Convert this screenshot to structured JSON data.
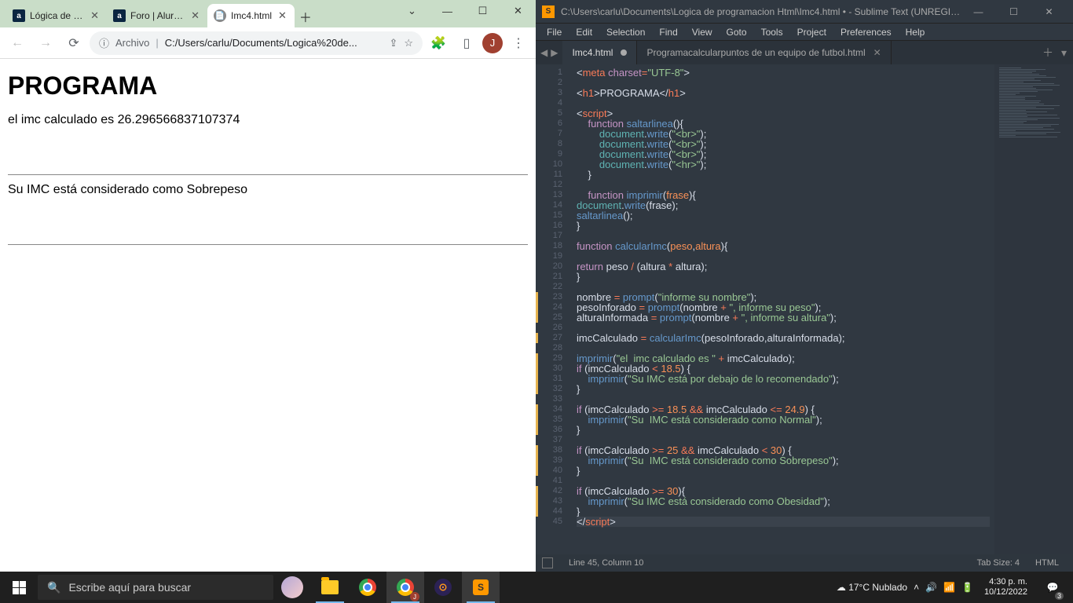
{
  "chrome": {
    "tabs": [
      {
        "title": "Lógica de pro",
        "fav": "a"
      },
      {
        "title": "Foro | Alura L",
        "fav": "a"
      },
      {
        "title": "Imc4.html",
        "fav": "",
        "active": true
      }
    ],
    "toolbar": {
      "file_label": "Archivo",
      "url": "C:/Users/carlu/Documents/Logica%20de..."
    },
    "avatar_letter": "J",
    "page": {
      "h1": "PROGRAMA",
      "p1": "el imc calculado es 26.296566837107374",
      "p2": "Su IMC está considerado como Sobrepeso"
    }
  },
  "sublime": {
    "title": "C:\\Users\\carlu\\Documents\\Logica de programacion Html\\Imc4.html • - Sublime Text (UNREGIS...",
    "menu": [
      "File",
      "Edit",
      "Selection",
      "Find",
      "View",
      "Goto",
      "Tools",
      "Project",
      "Preferences",
      "Help"
    ],
    "tabs": [
      {
        "title": "Imc4.html",
        "dirty": true,
        "active": true
      },
      {
        "title": "Programacalcularpuntos de un equipo de futbol.html",
        "dirty": false,
        "active": false
      }
    ],
    "status": {
      "pos": "Line 45, Column 10",
      "tabsize": "Tab Size: 4",
      "lang": "HTML"
    },
    "code": [
      {
        "n": 1,
        "html": "<span class='c-pun'>&lt;</span><span class='c-tag'>meta</span> <span class='c-attr'>charset</span><span class='c-op'>=</span><span class='c-str'>\"UTF-8\"</span><span class='c-pun'>&gt;</span>"
      },
      {
        "n": 2,
        "html": ""
      },
      {
        "n": 3,
        "html": "<span class='c-pun'>&lt;</span><span class='c-tag'>h1</span><span class='c-pun'>&gt;</span>PROGRAMA<span class='c-pun'>&lt;/</span><span class='c-tag'>h1</span><span class='c-pun'>&gt;</span>"
      },
      {
        "n": 4,
        "html": ""
      },
      {
        "n": 5,
        "html": "<span class='c-pun'>&lt;</span><span class='c-tag'>script</span><span class='c-pun'>&gt;</span>"
      },
      {
        "n": 6,
        "html": "    <span class='c-kw'>function</span> <span class='c-fn'>saltarlinea</span><span class='c-pun'>(){</span>"
      },
      {
        "n": 7,
        "html": "        <span class='c-obj'>document</span><span class='c-pun'>.</span><span class='c-fn'>write</span><span class='c-pun'>(</span><span class='c-str'>\"&lt;br&gt;\"</span><span class='c-pun'>);</span>"
      },
      {
        "n": 8,
        "html": "        <span class='c-obj'>document</span><span class='c-pun'>.</span><span class='c-fn'>write</span><span class='c-pun'>(</span><span class='c-str'>\"&lt;br&gt;\"</span><span class='c-pun'>);</span>"
      },
      {
        "n": 9,
        "html": "        <span class='c-obj'>document</span><span class='c-pun'>.</span><span class='c-fn'>write</span><span class='c-pun'>(</span><span class='c-str'>\"&lt;br&gt;\"</span><span class='c-pun'>);</span>"
      },
      {
        "n": 10,
        "html": "        <span class='c-obj'>document</span><span class='c-pun'>.</span><span class='c-fn'>write</span><span class='c-pun'>(</span><span class='c-str'>\"&lt;hr&gt;\"</span><span class='c-pun'>);</span>"
      },
      {
        "n": 11,
        "html": "    <span class='c-pun'>}</span>"
      },
      {
        "n": 12,
        "html": ""
      },
      {
        "n": 13,
        "html": "    <span class='c-kw'>function</span> <span class='c-fn'>imprimir</span><span class='c-pun'>(</span><span class='c-param'>frase</span><span class='c-pun'>){</span>"
      },
      {
        "n": 14,
        "html": "<span class='c-obj'>document</span><span class='c-pun'>.</span><span class='c-fn'>write</span><span class='c-pun'>(</span><span class='c-var'>frase</span><span class='c-pun'>);</span>"
      },
      {
        "n": 15,
        "html": "<span class='c-fn'>saltarlinea</span><span class='c-pun'>();</span>"
      },
      {
        "n": 16,
        "html": "<span class='c-pun'>}</span>"
      },
      {
        "n": 17,
        "html": ""
      },
      {
        "n": 18,
        "html": "<span class='c-kw'>function</span> <span class='c-fn'>calcularImc</span><span class='c-pun'>(</span><span class='c-param'>peso</span><span class='c-pun'>,</span><span class='c-param'>altura</span><span class='c-pun'>){</span>"
      },
      {
        "n": 19,
        "html": ""
      },
      {
        "n": 20,
        "html": "<span class='c-kw'>return</span> <span class='c-var'>peso</span> <span class='c-op'>/</span> <span class='c-pun'>(</span><span class='c-var'>altura</span> <span class='c-op'>*</span> <span class='c-var'>altura</span><span class='c-pun'>);</span>"
      },
      {
        "n": 21,
        "html": "<span class='c-pun'>}</span>"
      },
      {
        "n": 22,
        "html": ""
      },
      {
        "n": 23,
        "mod": true,
        "html": "<span class='c-var'>nombre</span> <span class='c-op'>=</span> <span class='c-fn'>prompt</span><span class='c-pun'>(</span><span class='c-str'>\"informe su nombre\"</span><span class='c-pun'>);</span>"
      },
      {
        "n": 24,
        "mod": true,
        "html": "<span class='c-var'>pesoInforado</span> <span class='c-op'>=</span> <span class='c-fn'>prompt</span><span class='c-pun'>(</span><span class='c-var'>nombre</span> <span class='c-op'>+</span> <span class='c-str'>\", informe su peso\"</span><span class='c-pun'>);</span>"
      },
      {
        "n": 25,
        "mod": true,
        "html": "<span class='c-var'>alturaInformada</span> <span class='c-op'>=</span> <span class='c-fn'>prompt</span><span class='c-pun'>(</span><span class='c-var'>nombre</span> <span class='c-op'>+</span> <span class='c-str'>\", informe su altura\"</span><span class='c-pun'>);</span>"
      },
      {
        "n": 26,
        "html": ""
      },
      {
        "n": 27,
        "mod": true,
        "html": "<span class='c-var'>imcCalculado</span> <span class='c-op'>=</span> <span class='c-fn'>calcularImc</span><span class='c-pun'>(</span><span class='c-var'>pesoInforado</span><span class='c-pun'>,</span><span class='c-var'>alturaInformada</span><span class='c-pun'>);</span>"
      },
      {
        "n": 28,
        "html": ""
      },
      {
        "n": 29,
        "mod": true,
        "html": "<span class='c-fn'>imprimir</span><span class='c-pun'>(</span><span class='c-str'>\"el  imc calculado es \"</span> <span class='c-op'>+</span> <span class='c-var'>imcCalculado</span><span class='c-pun'>);</span>"
      },
      {
        "n": 30,
        "mod": true,
        "html": "<span class='c-kw'>if</span> <span class='c-pun'>(</span><span class='c-var'>imcCalculado</span> <span class='c-op'>&lt;</span> <span class='c-num'>18.5</span><span class='c-pun'>) {</span>"
      },
      {
        "n": 31,
        "mod": true,
        "html": "    <span class='c-fn'>imprimir</span><span class='c-pun'>(</span><span class='c-str'>\"Su IMC está por debajo de lo recomendado\"</span><span class='c-pun'>);</span>"
      },
      {
        "n": 32,
        "mod": true,
        "html": "<span class='c-pun'>}</span>"
      },
      {
        "n": 33,
        "html": ""
      },
      {
        "n": 34,
        "mod": true,
        "html": "<span class='c-kw'>if</span> <span class='c-pun'>(</span><span class='c-var'>imcCalculado</span> <span class='c-op'>&gt;=</span> <span class='c-num'>18.5</span> <span class='c-op'>&amp;&amp;</span> <span class='c-var'>imcCalculado</span> <span class='c-op'>&lt;=</span> <span class='c-num'>24.9</span><span class='c-pun'>) {</span>"
      },
      {
        "n": 35,
        "mod": true,
        "html": "    <span class='c-fn'>imprimir</span><span class='c-pun'>(</span><span class='c-str'>\"Su  IMC está considerado como Normal\"</span><span class='c-pun'>);</span>"
      },
      {
        "n": 36,
        "mod": true,
        "html": "<span class='c-pun'>}</span>"
      },
      {
        "n": 37,
        "html": ""
      },
      {
        "n": 38,
        "mod": true,
        "html": "<span class='c-kw'>if</span> <span class='c-pun'>(</span><span class='c-var'>imcCalculado</span> <span class='c-op'>&gt;=</span> <span class='c-num'>25</span> <span class='c-op'>&amp;&amp;</span> <span class='c-var'>imcCalculado</span> <span class='c-op'>&lt;</span> <span class='c-num'>30</span><span class='c-pun'>) {</span>"
      },
      {
        "n": 39,
        "mod": true,
        "html": "    <span class='c-fn'>imprimir</span><span class='c-pun'>(</span><span class='c-str'>\"Su  IMC está considerado como Sobrepeso\"</span><span class='c-pun'>);</span>"
      },
      {
        "n": 40,
        "mod": true,
        "html": "<span class='c-pun'>}</span>"
      },
      {
        "n": 41,
        "html": ""
      },
      {
        "n": 42,
        "mod": true,
        "html": "<span class='c-kw'>if</span> <span class='c-pun'>(</span><span class='c-var'>imcCalculado</span> <span class='c-op'>&gt;=</span> <span class='c-num'>30</span><span class='c-pun'>){</span>"
      },
      {
        "n": 43,
        "mod": true,
        "html": "    <span class='c-fn'>imprimir</span><span class='c-pun'>(</span><span class='c-str'>\"Su IMC está considerado como Obesidad\"</span><span class='c-pun'>);</span>"
      },
      {
        "n": 44,
        "mod": true,
        "html": "<span class='c-pun'>}</span>"
      },
      {
        "n": 45,
        "cur": true,
        "html": "<span class='c-pun'>&lt;/</span><span class='c-tag'>script</span><span class='c-pun'>&gt;</span>"
      }
    ]
  },
  "taskbar": {
    "search_placeholder": "Escribe aquí para buscar",
    "weather": "17°C  Nublado",
    "time": "4:30 p. m.",
    "date": "10/12/2022",
    "noti_count": "3"
  }
}
